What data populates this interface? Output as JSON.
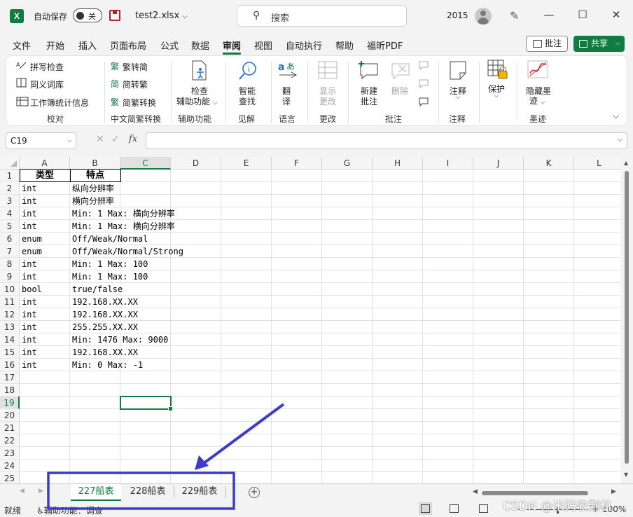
{
  "titlebar": {
    "app_icon": "X",
    "autosave_label": "自动保存",
    "autosave_state": "关",
    "filename": "test2.xlsx",
    "search_placeholder": "搜索",
    "year": "2015",
    "icons": [
      "excel-logo-icon",
      "save-icon",
      "chevron-down-icon",
      "search-icon",
      "avatar-icon",
      "pen-icon",
      "minimize-icon",
      "maximize-icon",
      "close-icon"
    ]
  },
  "menu": {
    "items": [
      "文件",
      "开始",
      "插入",
      "页面布局",
      "公式",
      "数据",
      "审阅",
      "视图",
      "自动执行",
      "帮助",
      "福昕PDF"
    ],
    "active": "审阅",
    "comment_button": "批注",
    "share_button": "共享"
  },
  "ribbon": {
    "spell_check": "拼写检查",
    "thesaurus": "同义词库",
    "workbook_stats": "工作簿统计信息",
    "group_proofing": "校对",
    "trad_to_simp": "繁转简",
    "simp_to_trad": "简转繁",
    "convert": "简繁转换",
    "group_chinese": "中文简繁转换",
    "check_access_1": "检查",
    "check_access_2": "辅助功能",
    "group_access": "辅助功能",
    "smart_lookup_1": "智能",
    "smart_lookup_2": "查找",
    "group_insights": "见解",
    "translate_1": "翻",
    "translate_2": "译",
    "group_language": "语言",
    "show_changes_1": "显示",
    "show_changes_2": "更改",
    "group_changes": "更改",
    "new_comment_1": "新建",
    "new_comment_2": "批注",
    "delete": "删除",
    "group_comments": "批注",
    "notes": "注释",
    "group_notes": "注释",
    "protect": "保护",
    "hide_ink_1": "隐藏墨",
    "hide_ink_2": "迹",
    "group_ink": "墨迹"
  },
  "formula_bar": {
    "name_box": "C19",
    "fx": "fx",
    "value": ""
  },
  "grid": {
    "columns": [
      "A",
      "B",
      "C",
      "D",
      "E",
      "F",
      "G",
      "H",
      "I",
      "J",
      "K",
      "L"
    ],
    "selected_column": "C",
    "selected_row": 19,
    "row_numbers": [
      "1",
      "2",
      "3",
      "4",
      "5",
      "6",
      "7",
      "8",
      "9",
      "10",
      "11",
      "12",
      "13",
      "14",
      "15",
      "16",
      "17",
      "18",
      "19",
      "20",
      "21",
      "22",
      "23",
      "24",
      "25"
    ],
    "rows": [
      [
        "类型",
        "特点"
      ],
      [
        "int",
        "纵向分辨率"
      ],
      [
        "int",
        "横向分辨率"
      ],
      [
        "int",
        "Min: 1 Max: 横向分辨率"
      ],
      [
        "int",
        "Min: 1 Max: 横向分辨率"
      ],
      [
        "enum",
        "Off/Weak/Normal"
      ],
      [
        "enum",
        "Off/Weak/Normal/Strong"
      ],
      [
        "int",
        "Min: 1 Max: 100"
      ],
      [
        "int",
        "Min: 1 Max: 100"
      ],
      [
        "bool",
        "true/false"
      ],
      [
        "int",
        "192.168.XX.XX"
      ],
      [
        "int",
        "192.168.XX.XX"
      ],
      [
        "int",
        "255.255.XX.XX"
      ],
      [
        "int",
        "Min: 1476 Max: 9000"
      ],
      [
        "int",
        "192.168.XX.XX"
      ],
      [
        "int",
        "Min: 0 Max: -1"
      ]
    ]
  },
  "sheets": {
    "tabs": [
      "227船表",
      "228船表",
      "229船表"
    ],
    "active_index": 0
  },
  "status": {
    "ready": "就绪",
    "accessibility": "辅助功能：调查",
    "zoom": "100%"
  },
  "watermark": "CSDN @米码收割机",
  "annotation": {
    "color": "#3b3bcc"
  }
}
